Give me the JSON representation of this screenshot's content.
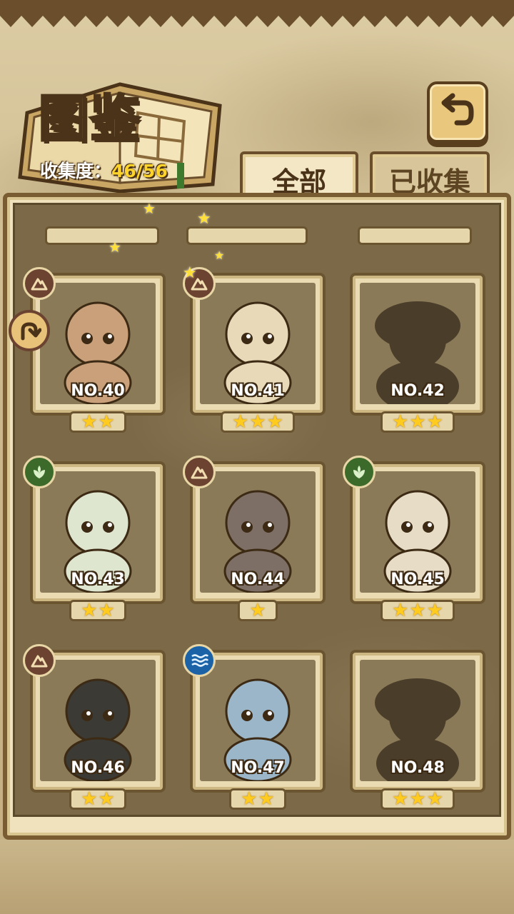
{
  "header": {
    "title": "图鉴",
    "collection_label": "收集度：",
    "collection_value": "46/56"
  },
  "tabs": [
    {
      "label": "全部",
      "active": true
    },
    {
      "label": "已收集",
      "active": false
    }
  ],
  "icons": {
    "back": "return-arrow-icon",
    "side": "curved-arrow-icon",
    "earth": "mountain-icon",
    "leaf": "leaf-icon",
    "water": "water-waves-icon",
    "star": "star-icon"
  },
  "colors": {
    "star": "#ffcb1f",
    "earth": "#6b4330",
    "leaf": "#3c6a2a",
    "water": "#1b63a6"
  },
  "cards": [
    {
      "number": "NO.40",
      "stars": 2,
      "element": "earth",
      "collected": true
    },
    {
      "number": "NO.41",
      "stars": 3,
      "element": "earth",
      "collected": true
    },
    {
      "number": "NO.42",
      "stars": 3,
      "element": "",
      "collected": false
    },
    {
      "number": "NO.43",
      "stars": 2,
      "element": "leaf",
      "collected": true
    },
    {
      "number": "NO.44",
      "stars": 1,
      "element": "earth",
      "collected": true
    },
    {
      "number": "NO.45",
      "stars": 3,
      "element": "leaf",
      "collected": true
    },
    {
      "number": "NO.46",
      "stars": 2,
      "element": "earth",
      "collected": true
    },
    {
      "number": "NO.47",
      "stars": 2,
      "element": "water",
      "collected": true
    },
    {
      "number": "NO.48",
      "stars": 3,
      "element": "",
      "collected": false
    }
  ]
}
